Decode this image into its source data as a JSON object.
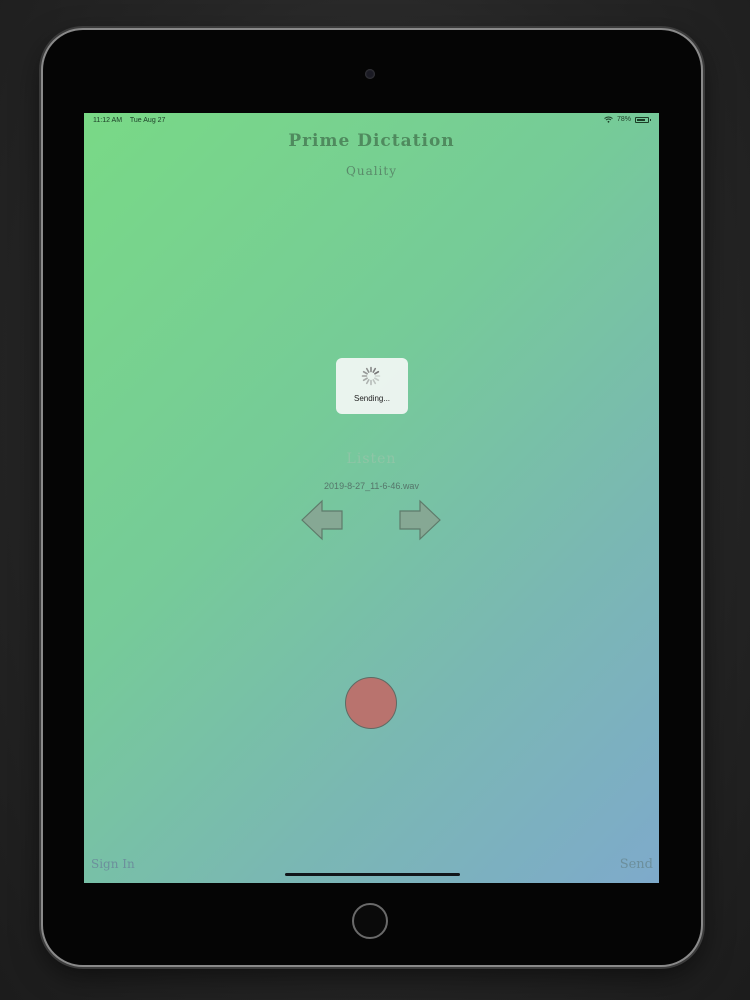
{
  "status_bar": {
    "time": "11:12 AM",
    "date": "Tue Aug 27",
    "battery": "78%",
    "battery_level": 0.78,
    "wifi_icon": "wifi-icon"
  },
  "app": {
    "title": "Prime Dictation",
    "quality_label": "Quality"
  },
  "hud": {
    "message": "Sending..."
  },
  "player": {
    "listen_label": "Listen",
    "filename": "2019-8-27_11-6-46.wav",
    "prev_icon": "arrow-left-icon",
    "next_icon": "arrow-right-icon"
  },
  "record": {
    "icon": "record-button",
    "color": "#b9736e"
  },
  "footer": {
    "sign_in_label": "Sign In",
    "send_label": "Send"
  },
  "colors": {
    "gradient_start": "#79d986",
    "gradient_end": "#7eaacb",
    "title_color": "#4f8a5e"
  }
}
